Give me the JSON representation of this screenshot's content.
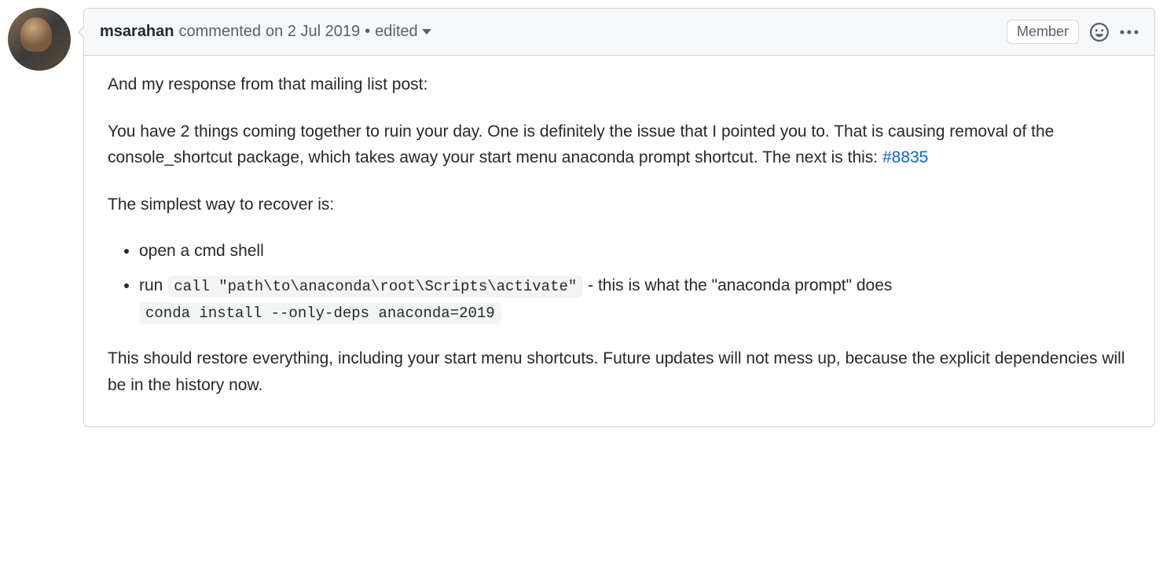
{
  "header": {
    "author": "msarahan",
    "commented_prefix": "commented",
    "timestamp": "on 2 Jul 2019",
    "edited": "edited",
    "badge": "Member"
  },
  "body": {
    "p1": "And my response from that mailing list post:",
    "p2_part1": "You have 2 things coming together to ruin your day. One is definitely the issue that I pointed you to. That is causing removal of the console_shortcut package, which takes away your start menu anaconda prompt shortcut. The next is this: ",
    "p2_link": "#8835",
    "p3": "The simplest way to recover is:",
    "li1": "open a cmd shell",
    "li2_prefix": "run ",
    "li2_code1": "call \"path\\to\\anaconda\\root\\Scripts\\activate\"",
    "li2_suffix": " - this is what the \"anaconda prompt\" does",
    "li2_code2": "conda install --only-deps anaconda=2019",
    "p4": "This should restore everything, including your start menu shortcuts. Future updates will not mess up, because the explicit dependencies will be in the history now."
  }
}
